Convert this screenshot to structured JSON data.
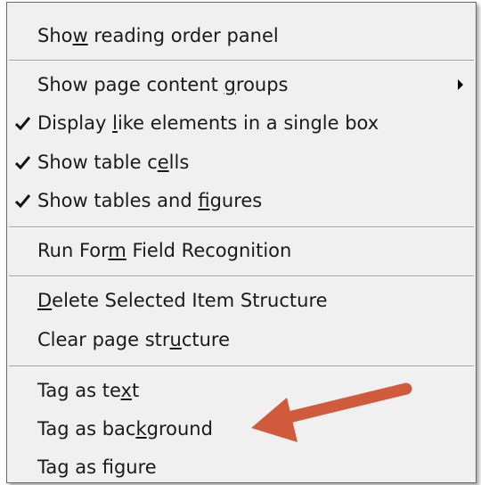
{
  "menu": {
    "items": [
      {
        "pre": "Sho",
        "acc": "w",
        "post": " reading order panel",
        "checked": false,
        "submenu": false
      },
      {
        "pre": "Show page content ",
        "acc": "g",
        "post": "roups",
        "checked": false,
        "submenu": true
      },
      {
        "pre": "Display ",
        "acc": "l",
        "post": "ike elements in a single box",
        "checked": true,
        "submenu": false
      },
      {
        "pre": "Show table c",
        "acc": "e",
        "post": "lls",
        "checked": true,
        "submenu": false
      },
      {
        "pre": "Show tables and ",
        "acc": "f",
        "post": "igures",
        "checked": true,
        "submenu": false
      },
      {
        "pre": "Run For",
        "acc": "m",
        "post": " Field Recognition",
        "checked": false,
        "submenu": false
      },
      {
        "pre": "",
        "acc": "D",
        "post": "elete Selected Item Structure",
        "checked": false,
        "submenu": false
      },
      {
        "pre": "Clear page str",
        "acc": "u",
        "post": "cture",
        "checked": false,
        "submenu": false
      },
      {
        "pre": "Tag as te",
        "acc": "x",
        "post": "t",
        "checked": false,
        "submenu": false
      },
      {
        "pre": "Tag as bac",
        "acc": "k",
        "post": "ground",
        "checked": false,
        "submenu": false
      },
      {
        "pre": "Tag as figure",
        "acc": "",
        "post": "",
        "checked": false,
        "submenu": false
      }
    ]
  },
  "icons": {
    "check": "checkmark-icon",
    "submenu": "submenu-arrow-icon"
  },
  "colors": {
    "menu_bg": "#f0f0f0",
    "callout_arrow": "#d05a3c"
  }
}
